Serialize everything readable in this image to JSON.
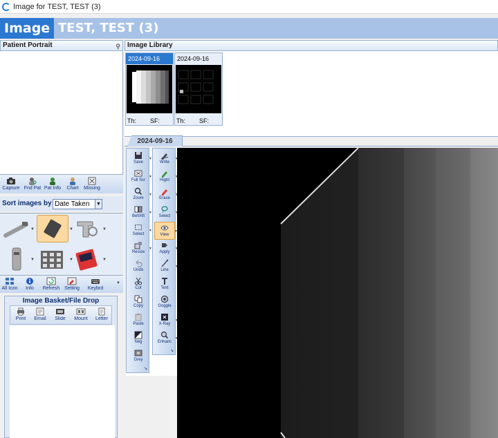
{
  "window": {
    "title": "Image for TEST, TEST (3)"
  },
  "banner": {
    "module": "Image",
    "patient": "TEST, TEST (3)"
  },
  "portrait": {
    "title": "Patient Portrait"
  },
  "patient_toolbar": [
    "Capture",
    "Fnd Pat",
    "Pat Info",
    "Chart",
    "Missing"
  ],
  "sort": {
    "label": "Sort images by",
    "value": "Date Taken"
  },
  "action_toolbar": [
    "All Icon",
    "Info",
    "Refresh",
    "Setting",
    "Keybrd"
  ],
  "basket": {
    "title": "Image Basket/File Drop",
    "buttons": [
      "Print",
      "Email",
      "Slide",
      "Mount",
      "Letter"
    ]
  },
  "library": {
    "title": "Image Library",
    "thumbnails": [
      {
        "date": "2024-09-16",
        "th": "Th:",
        "sf": "SF:",
        "selected": true
      },
      {
        "date": "2024-09-16",
        "th": "Th:",
        "sf": "SF:",
        "selected": false
      }
    ],
    "date_tab": "2024-09-16"
  },
  "tools_left": [
    "Save",
    "Full Scr",
    "Zoom",
    "Bef/Aft",
    "Select",
    "Resize",
    "Undo",
    "Cut",
    "Copy",
    "Paste",
    "Neg",
    "Grey"
  ],
  "tools_right": [
    "Write",
    "Hight",
    "Erase",
    "Select",
    "View",
    "Apply",
    "Line",
    "Text",
    "Goggle",
    "X-Ray",
    "Enhanc"
  ],
  "colors": {
    "banner_dark": "#2b78d1",
    "banner_light": "#a7c2e6",
    "panel_border": "#98afcc",
    "active_tool": "#fbd9a0"
  }
}
